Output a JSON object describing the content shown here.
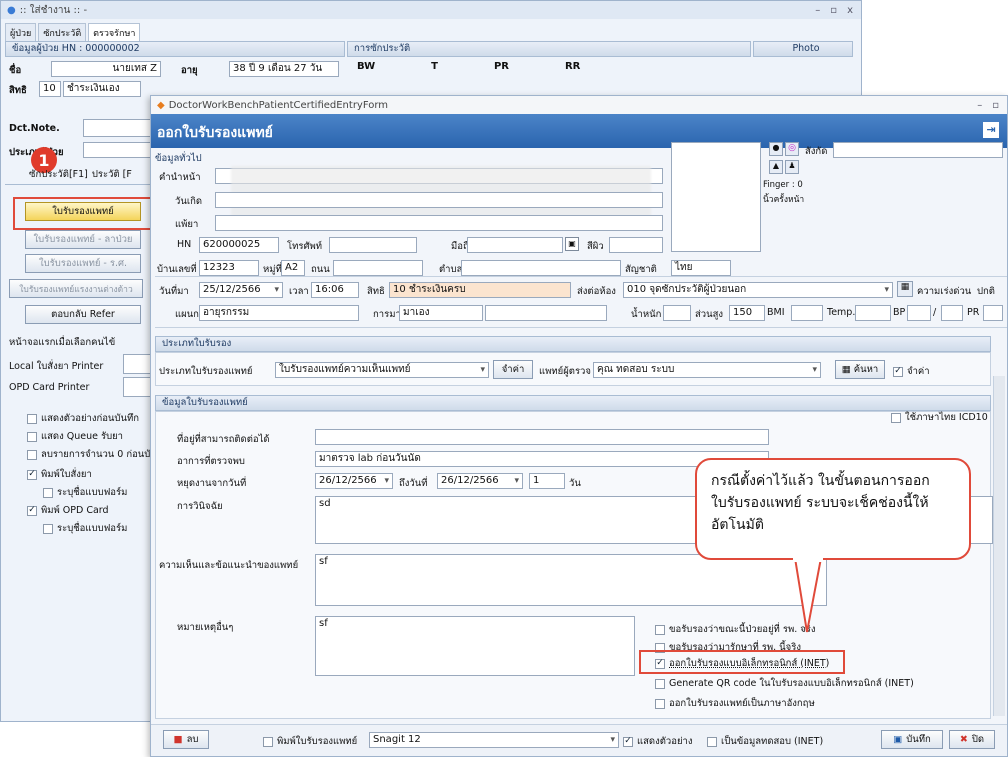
{
  "bg": {
    "title": ":: ใส่ชำงาน :: -",
    "tabs": [
      "ผู้ป่วย",
      "ซักประวัติ",
      "ตรวจรักษา"
    ],
    "patient_hdr": "ข้อมูลผู้ป่วย HN : 000000002",
    "history_hdr": "การซักประวัติ",
    "photo_hdr": "Photo",
    "name_label": "ชื่อ",
    "name_value": "นายเทส Z",
    "age_label": "อายุ",
    "age_value": "38 ปี 9 เดือน 27 วัน",
    "right_label": "สิทธิ",
    "right_code": "10",
    "right_value": "ชำระเงินเอง",
    "dct_label": "Dct.Note.",
    "type_label": "ประเภทผู้ป่วย",
    "vitals": [
      "BW",
      "T",
      "PR",
      "RR"
    ],
    "step_number": "1",
    "left_tabs": [
      "ซักประวัติ[F1]",
      "ประวัติ [F"
    ],
    "menu_buttons": [
      "ใบรับรองแพทย์",
      "ใบรับรองแพทย์ - ลาป่วย",
      "ใบรับรองแพทย์ - ร.ศ.",
      "ใบรับรองแพทย์แรงงานต่างด้าว",
      "ตอบกลับ Refer"
    ],
    "first_page_label": "หน้าจอแรกเมื่อเลือกคนไข้",
    "local_printer_label": "Local ใบสั่งยา Printer",
    "opd_printer_label": "OPD Card Printer",
    "options": [
      "แสดงตัวอย่างก่อนบันทึก",
      "แสดง Queue รับยา",
      "ลบรายการจำนวน 0 ก่อนบันทึ",
      "พิมพ์ใบสั่งยา",
      "ระบุชื่อแบบฟอร์ม",
      "พิมพ์ OPD Card",
      "ระบุชื่อแบบฟอร์ม"
    ]
  },
  "form": {
    "window_title": "DoctorWorkBenchPatientCertifiedEntryForm",
    "header": "ออกใบรับรองแพทย์",
    "general_hdr": "ข้อมูลทั่วไป",
    "prefix_label": "คำนำหน้า",
    "birth_label": "วันเกิด",
    "allergy_label": "แพ้ยา",
    "hn_label": "HN",
    "hn_value": "620000025",
    "phone_label": "โทรศัพท์",
    "mobile_label": "มือถือ",
    "skin_label": "สีผิว",
    "house_label": "บ้านเลขที่",
    "house_value": "12323",
    "moo_label": "หมู่ที่",
    "moo_value": "A2",
    "road_label": "ถนน",
    "tambon_label": "ตำบล",
    "nation_label": "สัญชาติ",
    "nation_value": "ไทย",
    "affil_label": "สังกัด",
    "finger_text": "Finger : 0",
    "finger_text2": "นิ้วครั้งหน้า",
    "visit_label": "วันที่มา",
    "visit_date": "25/12/2566",
    "time_label": "เวลา",
    "time_value": "16:06",
    "right_label": "สิทธิ",
    "right_value": "10 ชำระเงินครบ",
    "send_label": "ส่งต่อห้อง",
    "send_value": "010 จุดซักประวัติผู้ป่วยนอก",
    "urgency_label": "ความเร่งด่วน",
    "urgency_value": "ปกติ",
    "dept_label": "แผนก",
    "dept_value": "อายุรกรรม",
    "mode_label": "การมา",
    "mode_value": "มาเอง",
    "weight_label": "น้ำหนัก",
    "height_label": "ส่วนสูง",
    "height_value": "150",
    "bmi_label": "BMI",
    "temp_label": "Temp.",
    "bp_label": "BP",
    "bp_sep": "/",
    "pr_label": "PR",
    "cert_type_hdr": "ประเภทใบรับรอง",
    "cert_type_label": "ประเภทใบรับรองแพทย์",
    "cert_type_value": "ใบรับรองแพทย์ความเห็นแพทย์",
    "remember_btn": "จำค่า",
    "doctor_label": "แพทย์ผู้ตรวจ",
    "doctor_value": "คุณ ทดสอบ ระบบ",
    "search_btn": "ค้นหา",
    "remember_chk": "จำค่า",
    "cert_data_hdr": "ข้อมูลใบรับรองแพทย์",
    "thai_icd": "ใช้ภาษาไทย ICD10",
    "address_label": "ที่อยู่ที่สามารถติดต่อได้",
    "symptom_label": "อาการที่ตรวจพบ",
    "symptom_value": "มาตรวจ lab ก่อนวันนัด",
    "stop_label": "หยุดงานจากวันที่",
    "stop_from": "26/12/2566",
    "to_label": "ถึงวันที่",
    "stop_to": "26/12/2566",
    "days_value": "1",
    "days_label": "วัน",
    "diag_label": "การวินิจฉัย",
    "diag_value": "sd",
    "opinion_label": "ความเห็นและข้อแนะนำของแพทย์",
    "opinion_value": "sf",
    "note_label": "หมายเหตุอื่นๆ",
    "note_value": "sf",
    "right_checks": [
      "ขอรับรองว่าขณะนี้ป่วยอยู่ที่ รพ. จริง",
      "ขอรับรองว่ามารักษาที่ รพ. นี้จริง",
      "ออกใบรับรองแบบอิเล็กทรอนิกส์ (INET)",
      "Generate QR code ในใบรับรองแบบอิเล็กทรอนิกส์ (INET)",
      "ออกใบรับรองแพทย์เป็นภาษาอังกฤษ"
    ],
    "callout": "กรณีตั้งค่าไว้แล้ว ในขั้นตอนการออกใบรับรองแพทย์ ระบบจะเช็คช่องนี้ให้อัตโนมัติ",
    "delete_btn": "ลบ",
    "print_chk": "พิมพ์ใบรับรองแพทย์",
    "printer_value": "Snagit 12",
    "preview_chk": "แสดงตัวอย่าง",
    "test_chk": "เป็นข้อมูลทดสอบ (INET)",
    "save_btn": "บันทึก",
    "close_btn": "ปิด"
  }
}
